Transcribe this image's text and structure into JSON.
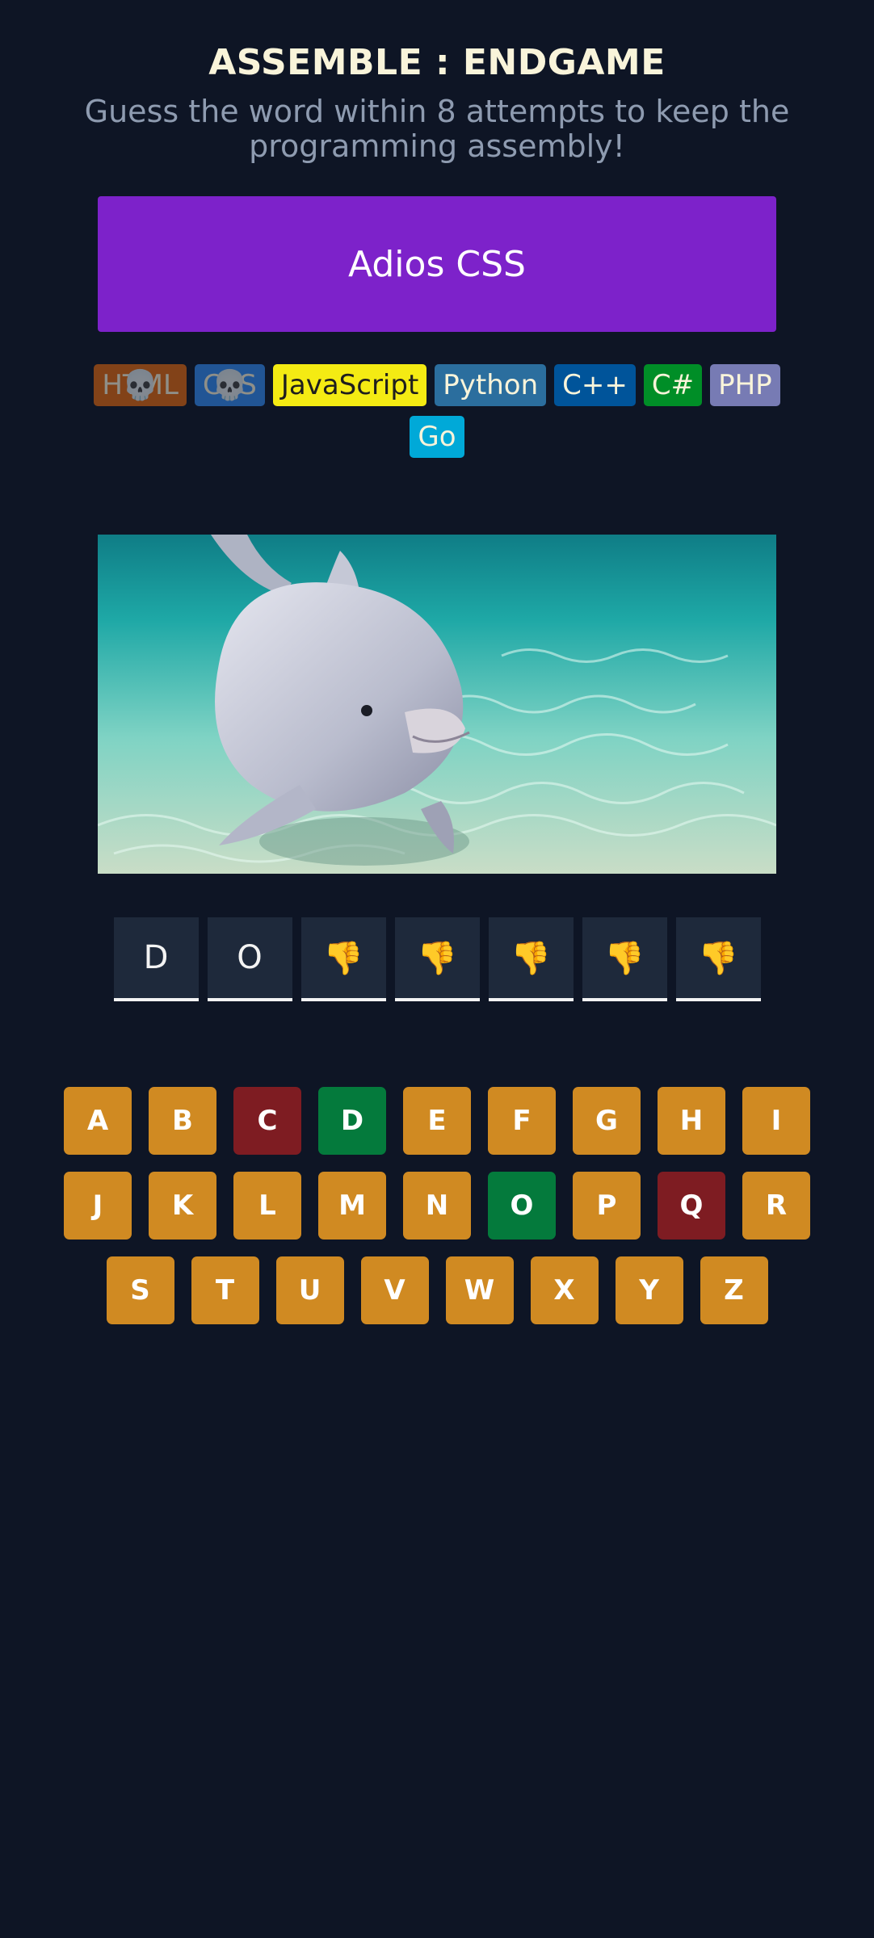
{
  "header": {
    "title": "ASSEMBLE : ENDGAME",
    "subtitle": "Guess the word within 8 attempts to keep the programming assembly!"
  },
  "status": {
    "message": "Adios CSS",
    "color": "#7d22ca"
  },
  "languages": [
    {
      "name": "HTML",
      "bg": "#e2680f",
      "fg": "#f9f4da",
      "lost": true
    },
    {
      "name": "CSS",
      "bg": "#328af1",
      "fg": "#f9f4da",
      "lost": true
    },
    {
      "name": "JavaScript",
      "bg": "#f4eb13",
      "fg": "#1e1e1e",
      "lost": false
    },
    {
      "name": "Python",
      "bg": "#2b6e9e",
      "fg": "#f9f4da",
      "lost": false
    },
    {
      "name": "C++",
      "bg": "#00549a",
      "fg": "#f9f4da",
      "lost": false
    },
    {
      "name": "C#",
      "bg": "#008e27",
      "fg": "#f9f4da",
      "lost": false
    },
    {
      "name": "PHP",
      "bg": "#777bb4",
      "fg": "#f9f4da",
      "lost": false
    },
    {
      "name": "Go",
      "bg": "#00a9d8",
      "fg": "#f9f4da",
      "lost": false
    }
  ],
  "lost_icon": "💀",
  "image": {
    "icon": "dolphin-photo"
  },
  "word": [
    "D",
    "O",
    "👎",
    "👎",
    "👎",
    "👎",
    "👎"
  ],
  "keyboard": {
    "rows": [
      [
        "A",
        "B",
        "C",
        "D",
        "E",
        "F",
        "G",
        "H",
        "I"
      ],
      [
        "J",
        "K",
        "L",
        "M",
        "N",
        "O",
        "P",
        "Q",
        "R"
      ],
      [
        "S",
        "T",
        "U",
        "V",
        "W",
        "X",
        "Y",
        "Z"
      ]
    ],
    "correct": [
      "D",
      "O"
    ],
    "wrong": [
      "C",
      "Q"
    ],
    "colors": {
      "default": "#d08a22",
      "correct": "#047a3c",
      "wrong": "#7e1c22"
    }
  }
}
